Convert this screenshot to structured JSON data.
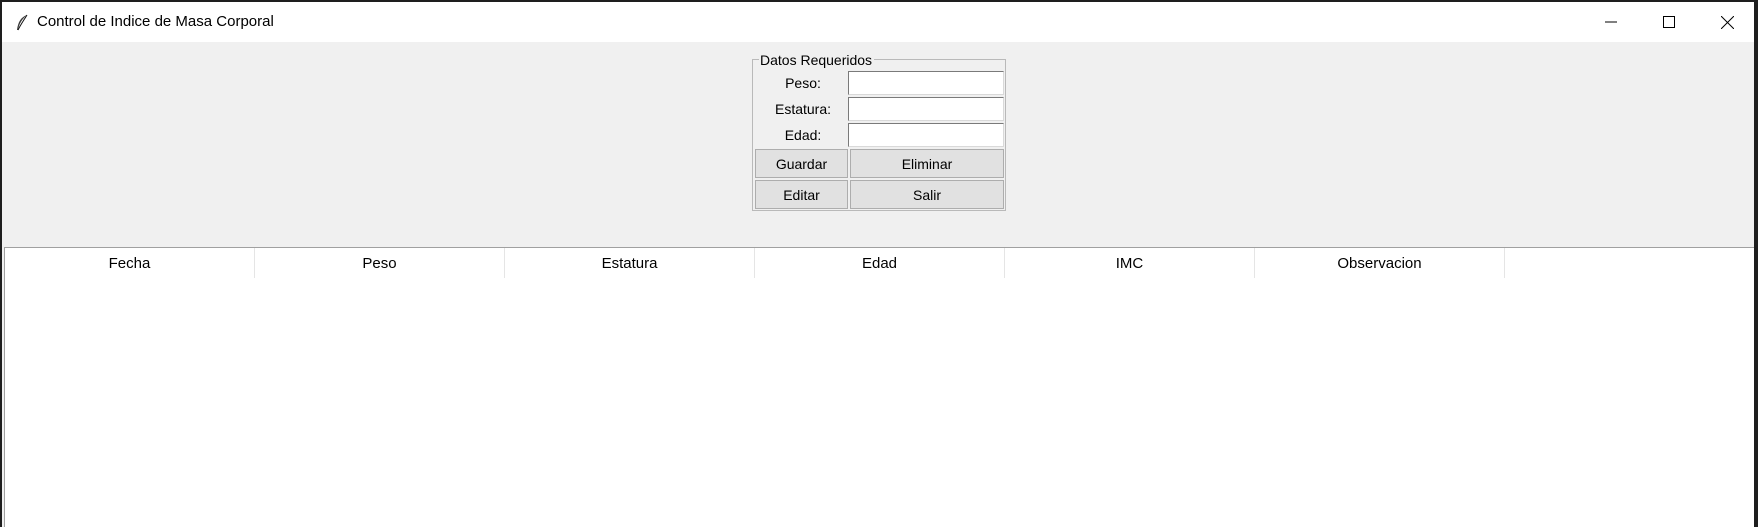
{
  "window": {
    "title": "Control de Indice de Masa Corporal",
    "icon": "feather-icon",
    "controls": [
      "minimize-icon",
      "maximize-icon",
      "close-icon"
    ]
  },
  "form": {
    "group_title": "Datos Requeridos",
    "fields": [
      {
        "label": "Peso:",
        "value": ""
      },
      {
        "label": "Estatura:",
        "value": ""
      },
      {
        "label": "Edad:",
        "value": ""
      }
    ],
    "buttons": {
      "guardar": "Guardar",
      "eliminar": "Eliminar",
      "editar": "Editar",
      "salir": "Salir"
    }
  },
  "table": {
    "columns": [
      "Fecha",
      "Peso",
      "Estatura",
      "Edad",
      "IMC",
      "Observacion"
    ],
    "rows": []
  }
}
